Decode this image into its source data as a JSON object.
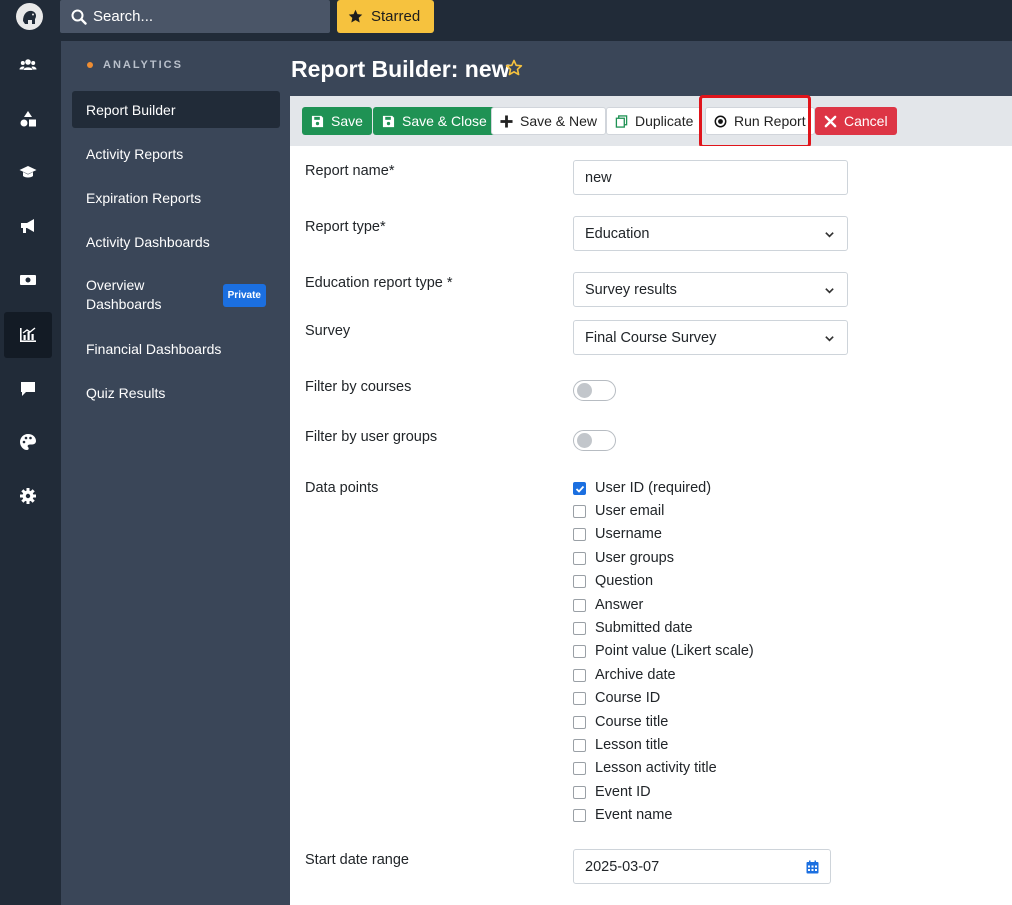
{
  "topbar": {
    "search_placeholder": "Search...",
    "starred_label": "Starred"
  },
  "rail": {
    "icons": [
      "users-icon",
      "shapes-icon",
      "graduation-cap-icon",
      "megaphone-icon",
      "money-icon",
      "analytics-chart-icon",
      "chat-icon",
      "palette-icon",
      "gear-icon"
    ],
    "active": "analytics-chart-icon"
  },
  "subnav": {
    "section_title": "ANALYTICS",
    "items": [
      {
        "label": "Report Builder"
      },
      {
        "label": "Activity Reports"
      },
      {
        "label": "Expiration Reports"
      },
      {
        "label": "Activity Dashboards"
      },
      {
        "label": "Overview Dashboards",
        "line1": "Overview",
        "line2": "Dashboards",
        "badge": "Private"
      },
      {
        "label": "Financial Dashboards"
      },
      {
        "label": "Quiz Results"
      }
    ]
  },
  "header": {
    "title": "Report Builder: new"
  },
  "toolbar": {
    "save": "Save",
    "save_close": "Save & Close",
    "save_new": "Save & New",
    "duplicate": "Duplicate",
    "run_report": "Run Report",
    "cancel": "Cancel"
  },
  "form": {
    "report_name": {
      "label": "Report name*",
      "value": "new"
    },
    "report_type": {
      "label": "Report type*",
      "value": "Education"
    },
    "education_report_type": {
      "label": "Education report type *",
      "value": "Survey results"
    },
    "survey": {
      "label": "Survey",
      "value": "Final Course Survey"
    },
    "filter_courses": {
      "label": "Filter by courses",
      "on": false
    },
    "filter_groups": {
      "label": "Filter by user groups",
      "on": false
    },
    "data_points": {
      "label": "Data points",
      "options": [
        {
          "label": "User ID (required)",
          "checked": true
        },
        {
          "label": "User email",
          "checked": false
        },
        {
          "label": "Username",
          "checked": false
        },
        {
          "label": "User groups",
          "checked": false
        },
        {
          "label": "Question",
          "checked": false
        },
        {
          "label": "Answer",
          "checked": false
        },
        {
          "label": "Submitted date",
          "checked": false
        },
        {
          "label": "Point value (Likert scale)",
          "checked": false
        },
        {
          "label": "Archive date",
          "checked": false
        },
        {
          "label": "Course ID",
          "checked": false
        },
        {
          "label": "Course title",
          "checked": false
        },
        {
          "label": "Lesson title",
          "checked": false
        },
        {
          "label": "Lesson activity title",
          "checked": false
        },
        {
          "label": "Event ID",
          "checked": false
        },
        {
          "label": "Event name",
          "checked": false
        }
      ]
    },
    "start_date": {
      "label": "Start date range",
      "value": "2025-03-07"
    }
  },
  "colors": {
    "accent_green": "#1f9254",
    "accent_red": "#dd3545",
    "highlight": "#e0141b",
    "starred": "#f6c23e"
  }
}
